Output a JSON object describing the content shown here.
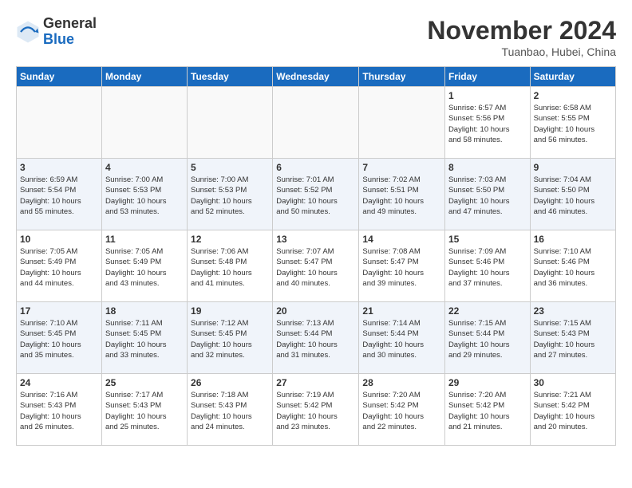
{
  "header": {
    "logo_line1": "General",
    "logo_line2": "Blue",
    "title": "November 2024",
    "subtitle": "Tuanbao, Hubei, China"
  },
  "weekdays": [
    "Sunday",
    "Monday",
    "Tuesday",
    "Wednesday",
    "Thursday",
    "Friday",
    "Saturday"
  ],
  "weeks": [
    [
      {
        "day": "",
        "info": ""
      },
      {
        "day": "",
        "info": ""
      },
      {
        "day": "",
        "info": ""
      },
      {
        "day": "",
        "info": ""
      },
      {
        "day": "",
        "info": ""
      },
      {
        "day": "1",
        "info": "Sunrise: 6:57 AM\nSunset: 5:56 PM\nDaylight: 10 hours\nand 58 minutes."
      },
      {
        "day": "2",
        "info": "Sunrise: 6:58 AM\nSunset: 5:55 PM\nDaylight: 10 hours\nand 56 minutes."
      }
    ],
    [
      {
        "day": "3",
        "info": "Sunrise: 6:59 AM\nSunset: 5:54 PM\nDaylight: 10 hours\nand 55 minutes."
      },
      {
        "day": "4",
        "info": "Sunrise: 7:00 AM\nSunset: 5:53 PM\nDaylight: 10 hours\nand 53 minutes."
      },
      {
        "day": "5",
        "info": "Sunrise: 7:00 AM\nSunset: 5:53 PM\nDaylight: 10 hours\nand 52 minutes."
      },
      {
        "day": "6",
        "info": "Sunrise: 7:01 AM\nSunset: 5:52 PM\nDaylight: 10 hours\nand 50 minutes."
      },
      {
        "day": "7",
        "info": "Sunrise: 7:02 AM\nSunset: 5:51 PM\nDaylight: 10 hours\nand 49 minutes."
      },
      {
        "day": "8",
        "info": "Sunrise: 7:03 AM\nSunset: 5:50 PM\nDaylight: 10 hours\nand 47 minutes."
      },
      {
        "day": "9",
        "info": "Sunrise: 7:04 AM\nSunset: 5:50 PM\nDaylight: 10 hours\nand 46 minutes."
      }
    ],
    [
      {
        "day": "10",
        "info": "Sunrise: 7:05 AM\nSunset: 5:49 PM\nDaylight: 10 hours\nand 44 minutes."
      },
      {
        "day": "11",
        "info": "Sunrise: 7:05 AM\nSunset: 5:49 PM\nDaylight: 10 hours\nand 43 minutes."
      },
      {
        "day": "12",
        "info": "Sunrise: 7:06 AM\nSunset: 5:48 PM\nDaylight: 10 hours\nand 41 minutes."
      },
      {
        "day": "13",
        "info": "Sunrise: 7:07 AM\nSunset: 5:47 PM\nDaylight: 10 hours\nand 40 minutes."
      },
      {
        "day": "14",
        "info": "Sunrise: 7:08 AM\nSunset: 5:47 PM\nDaylight: 10 hours\nand 39 minutes."
      },
      {
        "day": "15",
        "info": "Sunrise: 7:09 AM\nSunset: 5:46 PM\nDaylight: 10 hours\nand 37 minutes."
      },
      {
        "day": "16",
        "info": "Sunrise: 7:10 AM\nSunset: 5:46 PM\nDaylight: 10 hours\nand 36 minutes."
      }
    ],
    [
      {
        "day": "17",
        "info": "Sunrise: 7:10 AM\nSunset: 5:45 PM\nDaylight: 10 hours\nand 35 minutes."
      },
      {
        "day": "18",
        "info": "Sunrise: 7:11 AM\nSunset: 5:45 PM\nDaylight: 10 hours\nand 33 minutes."
      },
      {
        "day": "19",
        "info": "Sunrise: 7:12 AM\nSunset: 5:45 PM\nDaylight: 10 hours\nand 32 minutes."
      },
      {
        "day": "20",
        "info": "Sunrise: 7:13 AM\nSunset: 5:44 PM\nDaylight: 10 hours\nand 31 minutes."
      },
      {
        "day": "21",
        "info": "Sunrise: 7:14 AM\nSunset: 5:44 PM\nDaylight: 10 hours\nand 30 minutes."
      },
      {
        "day": "22",
        "info": "Sunrise: 7:15 AM\nSunset: 5:44 PM\nDaylight: 10 hours\nand 29 minutes."
      },
      {
        "day": "23",
        "info": "Sunrise: 7:15 AM\nSunset: 5:43 PM\nDaylight: 10 hours\nand 27 minutes."
      }
    ],
    [
      {
        "day": "24",
        "info": "Sunrise: 7:16 AM\nSunset: 5:43 PM\nDaylight: 10 hours\nand 26 minutes."
      },
      {
        "day": "25",
        "info": "Sunrise: 7:17 AM\nSunset: 5:43 PM\nDaylight: 10 hours\nand 25 minutes."
      },
      {
        "day": "26",
        "info": "Sunrise: 7:18 AM\nSunset: 5:43 PM\nDaylight: 10 hours\nand 24 minutes."
      },
      {
        "day": "27",
        "info": "Sunrise: 7:19 AM\nSunset: 5:42 PM\nDaylight: 10 hours\nand 23 minutes."
      },
      {
        "day": "28",
        "info": "Sunrise: 7:20 AM\nSunset: 5:42 PM\nDaylight: 10 hours\nand 22 minutes."
      },
      {
        "day": "29",
        "info": "Sunrise: 7:20 AM\nSunset: 5:42 PM\nDaylight: 10 hours\nand 21 minutes."
      },
      {
        "day": "30",
        "info": "Sunrise: 7:21 AM\nSunset: 5:42 PM\nDaylight: 10 hours\nand 20 minutes."
      }
    ]
  ]
}
